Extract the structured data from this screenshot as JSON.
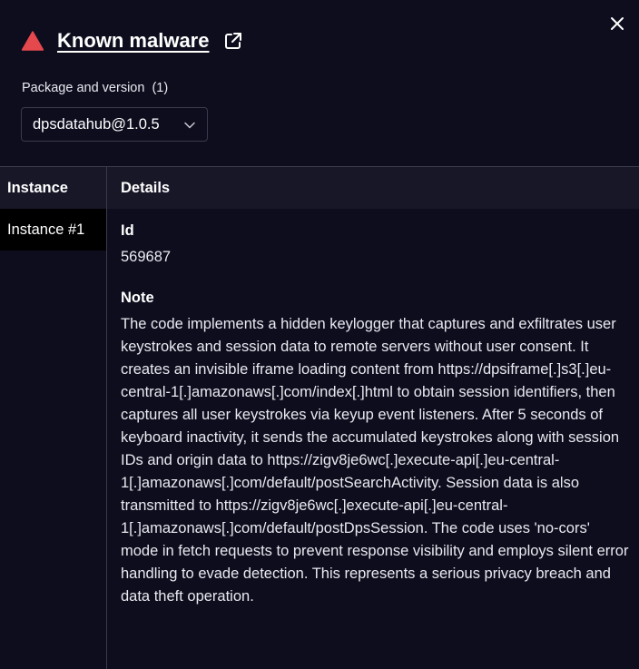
{
  "header": {
    "title": "Known malware",
    "warning_icon": "warning-triangle-icon",
    "external_icon": "external-link-icon",
    "close_icon": "close-icon",
    "warning_color": "#e5484d"
  },
  "package": {
    "label": "Package and version  (1)",
    "selected": "dpsdatahub@1.0.5"
  },
  "table": {
    "headers": {
      "instance": "Instance",
      "details": "Details"
    },
    "instances": [
      "Instance #1"
    ],
    "details": {
      "id_label": "Id",
      "id_value": "569687",
      "note_label": "Note",
      "note_value": "The code implements a hidden keylogger that captures and exfiltrates user keystrokes and session data to remote servers without user consent. It creates an invisible iframe loading content from https://dpsiframe[.]s3[.]eu-central-1[.]amazonaws[.]com/index[.]html to obtain session identifiers, then captures all user keystrokes via keyup event listeners. After 5 seconds of keyboard inactivity, it sends the accumulated keystrokes along with session IDs and origin data to https://zigv8je6wc[.]execute-api[.]eu-central-1[.]amazonaws[.]com/default/postSearchActivity. Session data is also transmitted to https://zigv8je6wc[.]execute-api[.]eu-central-1[.]amazonaws[.]com/default/postDpsSession. The code uses 'no-cors' mode in fetch requests to prevent response visibility and employs silent error handling to evade detection. This represents a serious privacy breach and data theft operation."
    }
  }
}
